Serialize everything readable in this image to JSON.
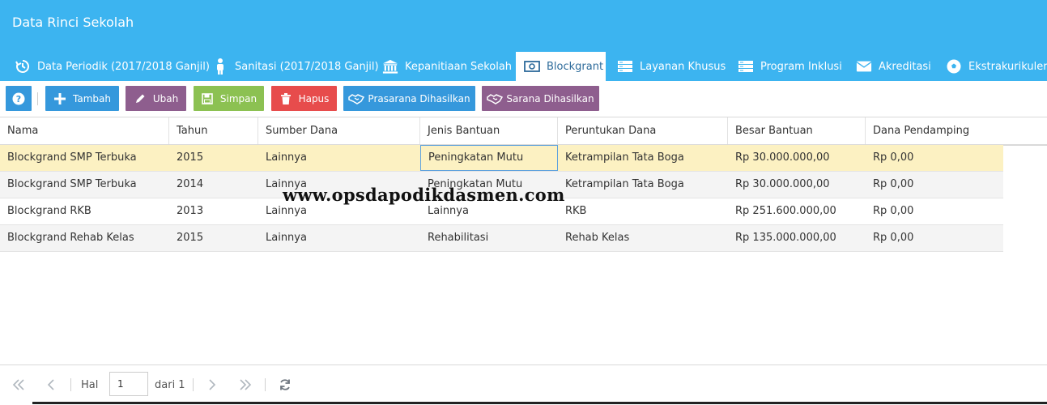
{
  "header": {
    "title": "Data Rinci Sekolah",
    "bg_color": "#3cb4f0"
  },
  "tabs": [
    {
      "label": "Data Periodik (2017/2018 Ganjil)",
      "icon": "history-icon"
    },
    {
      "label": "Sanitasi (2017/2018 Ganjil)",
      "icon": "person-icon"
    },
    {
      "label": "Kepanitiaan Sekolah",
      "icon": "institution-icon"
    },
    {
      "label": "Blockgrant",
      "icon": "money-icon",
      "active": true
    },
    {
      "label": "Layanan Khusus",
      "icon": "server-icon"
    },
    {
      "label": "Program Inklusi",
      "icon": "server-icon"
    },
    {
      "label": "Akreditasi",
      "icon": "envelope-icon"
    },
    {
      "label": "Ekstrakurikuler",
      "icon": "soccer-ball-icon"
    }
  ],
  "toolbar": {
    "help": {
      "color": "#3598dc",
      "icon": "question-icon"
    },
    "tambah": {
      "label": "Tambah",
      "color": "#3598dc",
      "icon": "plus-icon"
    },
    "ubah": {
      "label": "Ubah",
      "color": "#8e5e8e",
      "icon": "pencil-icon"
    },
    "simpan": {
      "label": "Simpan",
      "color": "#8cc152",
      "icon": "save-icon"
    },
    "hapus": {
      "label": "Hapus",
      "color": "#e74c4c",
      "icon": "trash-icon"
    },
    "prasarana": {
      "label": "Prasarana Dihasilkan",
      "color": "#3598dc",
      "icon": "handshake-icon"
    },
    "sarana": {
      "label": "Sarana Dihasilkan",
      "color": "#8e5e8e",
      "icon": "handshake-icon"
    }
  },
  "table": {
    "columns": [
      "Nama",
      "Tahun",
      "Sumber Dana",
      "Jenis Bantuan",
      "Peruntukan Dana",
      "Besar Bantuan",
      "Dana Pendamping"
    ],
    "rows": [
      [
        "Blockgrand SMP Terbuka",
        "2015",
        "Lainnya",
        "Peningkatan Mutu",
        "Ketrampilan Tata Boga",
        "Rp 30.000.000,00",
        "Rp 0,00"
      ],
      [
        "Blockgrand SMP Terbuka",
        "2014",
        "Lainnya",
        "Peningkatan Mutu",
        "Ketrampilan Tata Boga",
        "Rp 30.000.000,00",
        "Rp 0,00"
      ],
      [
        "Blockgrand RKB",
        "2013",
        "Lainnya",
        "Lainnya",
        "RKB",
        "Rp 251.600.000,00",
        "Rp 0,00"
      ],
      [
        "Blockgrand Rehab Kelas",
        "2015",
        "Lainnya",
        "Rehabilitasi",
        "Rehab Kelas",
        "Rp 135.000.000,00",
        "Rp 0,00"
      ]
    ],
    "selected_row_color": "#fcf1c2"
  },
  "watermark": "www.opsdapodikdasmen.com",
  "pager": {
    "page_label": "Hal",
    "page_value": "1",
    "of_label": "dari 1"
  }
}
